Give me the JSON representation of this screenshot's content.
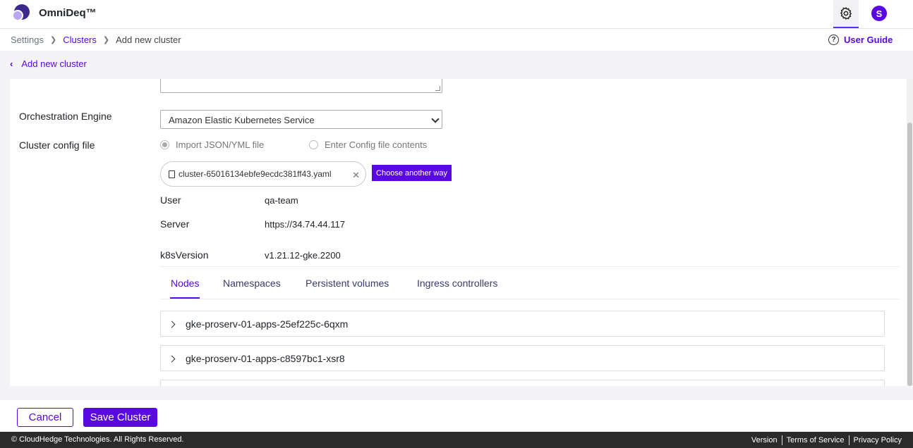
{
  "header": {
    "brand": "OmniDeq™",
    "avatar_initial": "S",
    "settings_icon": "gear-icon",
    "accent_color": "#5a08e0"
  },
  "breadcrumb": {
    "items": [
      "Settings",
      "Clusters",
      "Add new cluster"
    ]
  },
  "user_guide": {
    "icon": "question-circle-icon",
    "label": "User Guide"
  },
  "back_link": {
    "label": "Add new cluster"
  },
  "form": {
    "orchestration_label": "Orchestration Engine",
    "orchestration_value": "Amazon Elastic Kubernetes Service",
    "config_label": "Cluster config file",
    "radio_import": "Import JSON/YML file",
    "radio_enter": "Enter Config file contents",
    "file_name": "cluster-65016134ebfe9ecdc381ff43.yaml",
    "choose_another": "Choose another way",
    "details": [
      {
        "key": "User",
        "value": "qa-team"
      },
      {
        "key": "Server",
        "value": "https://34.74.44.117"
      },
      {
        "key": "k8sVersion",
        "value": "v1.21.12-gke.2200"
      }
    ]
  },
  "tabs": [
    "Nodes",
    "Namespaces",
    "Persistent volumes",
    "Ingress controllers"
  ],
  "nodes": [
    "gke-proserv-01-apps-25ef225c-6qxm",
    "gke-proserv-01-apps-c8597bc1-xsr8"
  ],
  "actions": {
    "cancel": "Cancel",
    "save": "Save Cluster"
  },
  "footer": {
    "copyright": "© CloudHedge Technologies. All Rights Reserved.",
    "version": "Version",
    "terms": "Terms of Service",
    "privacy": "Privacy Policy"
  }
}
